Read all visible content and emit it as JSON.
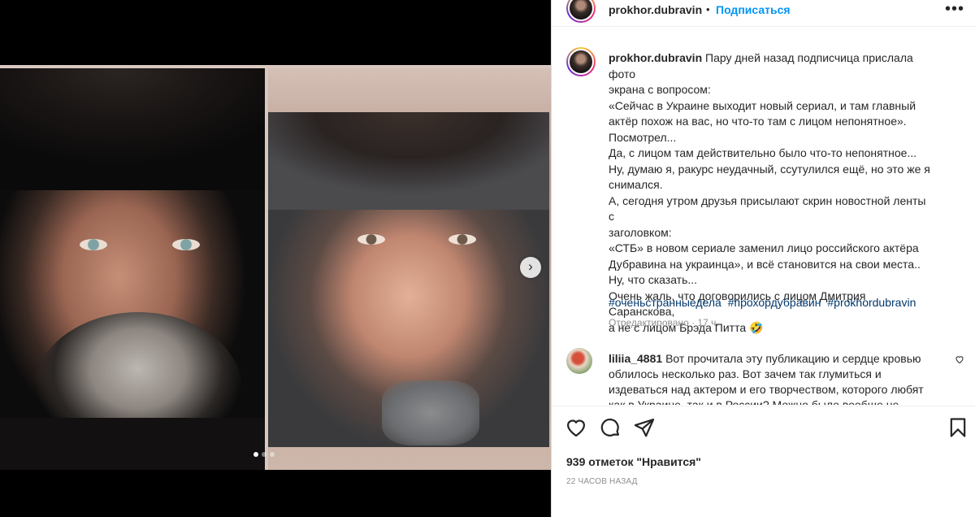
{
  "post": {
    "username": "prokhor.dubravin",
    "separator": "•",
    "follow_label": "Подписаться",
    "more_label": "•••",
    "caption_lines": [
      "Пару дней назад подписчица прислала фото",
      "экрана с вопросом:",
      "«Сейчас в Украине выходит новый сериал, и там главный",
      "актёр похож на вас, но что-то там с лицом непонятное».",
      "Посмотрел...",
      "Да, с лицом там действительно было что-то непонятное...",
      "Ну, думаю я, ракурс неудачный, ссутулился ещё, но это же я",
      "снимался.",
      "А, сегодня утром друзья присылают скрин новостной ленты с",
      "заголовком:",
      "«СТБ» в новом сериале заменил лицо российского актёра",
      "Дубравина на украинца», и всё становится на свои места..",
      "Ну, что сказать...",
      "Очень жаль, что договорились с лицом Дмитрия Саранскова,",
      "а не с лицом Брэда Питта 🤣"
    ],
    "hashtags": [
      "#оченьстранныедела",
      "#прохордубравин",
      "#prokhordubravin"
    ],
    "edited_label": "Отредактировано · 17 ч."
  },
  "comment": {
    "username": "liliia_4881",
    "text": "Вот прочитала эту публикацию и сердце кровью облилось несколько раз. Вот зачем так глумиться и издеваться над актером и его творчеством, которого любят как в Украине, так и в России? Можно было вообще не"
  },
  "footer": {
    "likes_label": "939 отметок \"Нравится\"",
    "time_label": "22 ЧАСОВ НАЗАД"
  },
  "carousel": {
    "next_label": "›",
    "slides_count": 3,
    "active_index": 0
  },
  "colors": {
    "link": "#0095f6",
    "hashtag": "#00376b",
    "muted": "#8e8e8e",
    "text": "#262626"
  },
  "icons": [
    "heart-icon",
    "comment-icon",
    "share-icon",
    "bookmark-icon",
    "comment-like-icon",
    "more-icon",
    "chevron-right-icon"
  ]
}
